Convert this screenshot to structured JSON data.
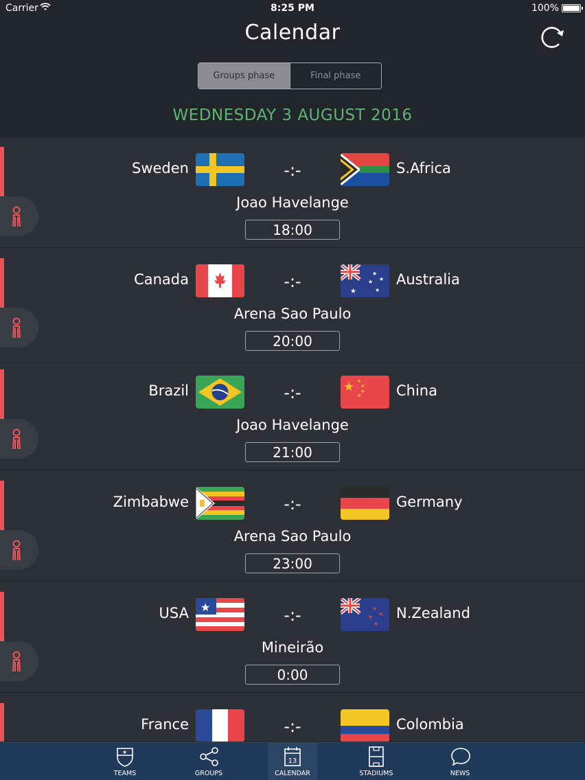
{
  "status_bar": {
    "carrier": "Carrier",
    "time": "8:25 PM",
    "battery": "100%"
  },
  "header": {
    "title": "Calendar"
  },
  "segments": [
    {
      "label": "Groups phase",
      "active": true
    },
    {
      "label": "Final phase",
      "active": false
    }
  ],
  "date_header": "WEDNESDAY 3 AUGUST 2016",
  "matches": [
    {
      "home": "Sweden",
      "away": "S.Africa",
      "score": "-:-",
      "venue": "Joao Havelange",
      "time": "18:00",
      "home_flag": "sweden-flag",
      "away_flag": "south-africa-flag"
    },
    {
      "home": "Canada",
      "away": "Australia",
      "score": "-:-",
      "venue": "Arena Sao Paulo",
      "time": "20:00",
      "home_flag": "canada-flag",
      "away_flag": "australia-flag"
    },
    {
      "home": "Brazil",
      "away": "China",
      "score": "-:-",
      "venue": "Joao Havelange",
      "time": "21:00",
      "home_flag": "brazil-flag",
      "away_flag": "china-flag"
    },
    {
      "home": "Zimbabwe",
      "away": "Germany",
      "score": "-:-",
      "venue": "Arena Sao Paulo",
      "time": "23:00",
      "home_flag": "zimbabwe-flag",
      "away_flag": "germany-flag"
    },
    {
      "home": "USA",
      "away": "N.Zealand",
      "score": "-:-",
      "venue": "Mineirão",
      "time": "0:00",
      "home_flag": "usa-flag",
      "away_flag": "new-zealand-flag"
    },
    {
      "home": "France",
      "away": "Colombia",
      "score": "-:-",
      "venue": "",
      "time": "",
      "home_flag": "france-flag",
      "away_flag": "colombia-flag"
    }
  ],
  "tabbar": {
    "items": [
      {
        "label": "TEAMS",
        "icon": "shield-icon"
      },
      {
        "label": "GROUPS",
        "icon": "share-icon"
      },
      {
        "label": "CALENDAR",
        "icon": "calendar-icon",
        "active": true,
        "day": "13"
      },
      {
        "label": "STADIUMS",
        "icon": "pitch-icon"
      },
      {
        "label": "NEWS",
        "icon": "speech-bubble-icon"
      }
    ]
  },
  "colors": {
    "accent_red": "#e8565a",
    "date_green": "#5eb56f",
    "tabbar_blue": "#1f3a5b",
    "row_bg": "#2e3038"
  }
}
